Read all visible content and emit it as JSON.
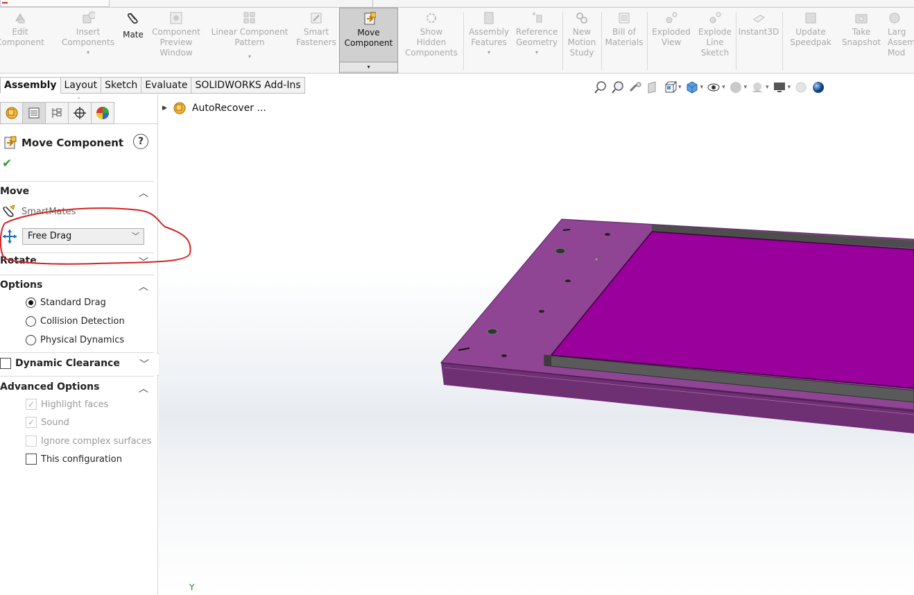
{
  "ribbon": {
    "buttons": [
      {
        "label": "Edit\nComponent",
        "icon": "edit-component-icon",
        "dropdown": ""
      },
      {
        "label": "Insert\nComponents",
        "icon": "insert-components-icon",
        "dropdown": "▾"
      },
      {
        "label": "Mate",
        "icon": "mate-paperclip-icon",
        "dropdown": ""
      },
      {
        "label": "Component\nPreview\nWindow",
        "icon": "component-preview-icon",
        "dropdown": ""
      },
      {
        "label": "Linear Component\nPattern",
        "icon": "linear-pattern-icon",
        "dropdown": "▾"
      },
      {
        "label": "Smart\nFasteners",
        "icon": "smart-fasteners-icon",
        "dropdown": ""
      },
      {
        "label": "Move\nComponent",
        "icon": "move-component-icon",
        "dropdown": "▾"
      },
      {
        "label": "Show\nHidden\nComponents",
        "icon": "show-hidden-icon",
        "dropdown": ""
      },
      {
        "label": "Assembly\nFeatures",
        "icon": "assembly-features-icon",
        "dropdown": "▾"
      },
      {
        "label": "Reference\nGeometry",
        "icon": "reference-geometry-icon",
        "dropdown": "▾"
      },
      {
        "label": "New\nMotion\nStudy",
        "icon": "motion-study-icon",
        "dropdown": ""
      },
      {
        "label": "Bill of\nMaterials",
        "icon": "bill-of-materials-icon",
        "dropdown": ""
      },
      {
        "label": "Exploded\nView",
        "icon": "exploded-view-icon",
        "dropdown": ""
      },
      {
        "label": "Explode\nLine\nSketch",
        "icon": "explode-line-icon",
        "dropdown": ""
      },
      {
        "label": "Instant3D",
        "icon": "instant3d-icon",
        "dropdown": ""
      },
      {
        "label": "Update\nSpeedpak",
        "icon": "speedpak-icon",
        "dropdown": ""
      },
      {
        "label": "Take\nSnapshot",
        "icon": "snapshot-icon",
        "dropdown": ""
      },
      {
        "label": "Larg\nAssem\nMod",
        "icon": "large-assembly-icon",
        "dropdown": ""
      }
    ]
  },
  "tabs": [
    "Assembly",
    "Layout",
    "Sketch",
    "Evaluate",
    "SOLIDWORKS Add-Ins"
  ],
  "tree": {
    "item": "AutoRecover ..."
  },
  "panel": {
    "title": "Move Component",
    "help": "?",
    "move": {
      "header": "Move",
      "smartmates": "SmartMates",
      "mode": "Free Drag"
    },
    "rotate": {
      "header": "Rotate"
    },
    "options": {
      "header": "Options",
      "items": [
        "Standard Drag",
        "Collision Detection",
        "Physical Dynamics"
      ],
      "selected": "Standard Drag"
    },
    "dynamic_clearance": {
      "label": "Dynamic Clearance"
    },
    "advanced": {
      "header": "Advanced Options",
      "items": [
        {
          "label": "Highlight faces",
          "checked": true,
          "enabled": false
        },
        {
          "label": "Sound",
          "checked": true,
          "enabled": false
        },
        {
          "label": "Ignore complex surfaces",
          "checked": false,
          "enabled": false
        },
        {
          "label": "This configuration",
          "checked": false,
          "enabled": true
        }
      ]
    }
  },
  "viewport": {
    "axis_label": "Y"
  },
  "colors": {
    "part_plate": "#8e3f93",
    "part_insert": "#9a009c",
    "annotation": "#d42020",
    "ok": "#2e9c2e"
  }
}
